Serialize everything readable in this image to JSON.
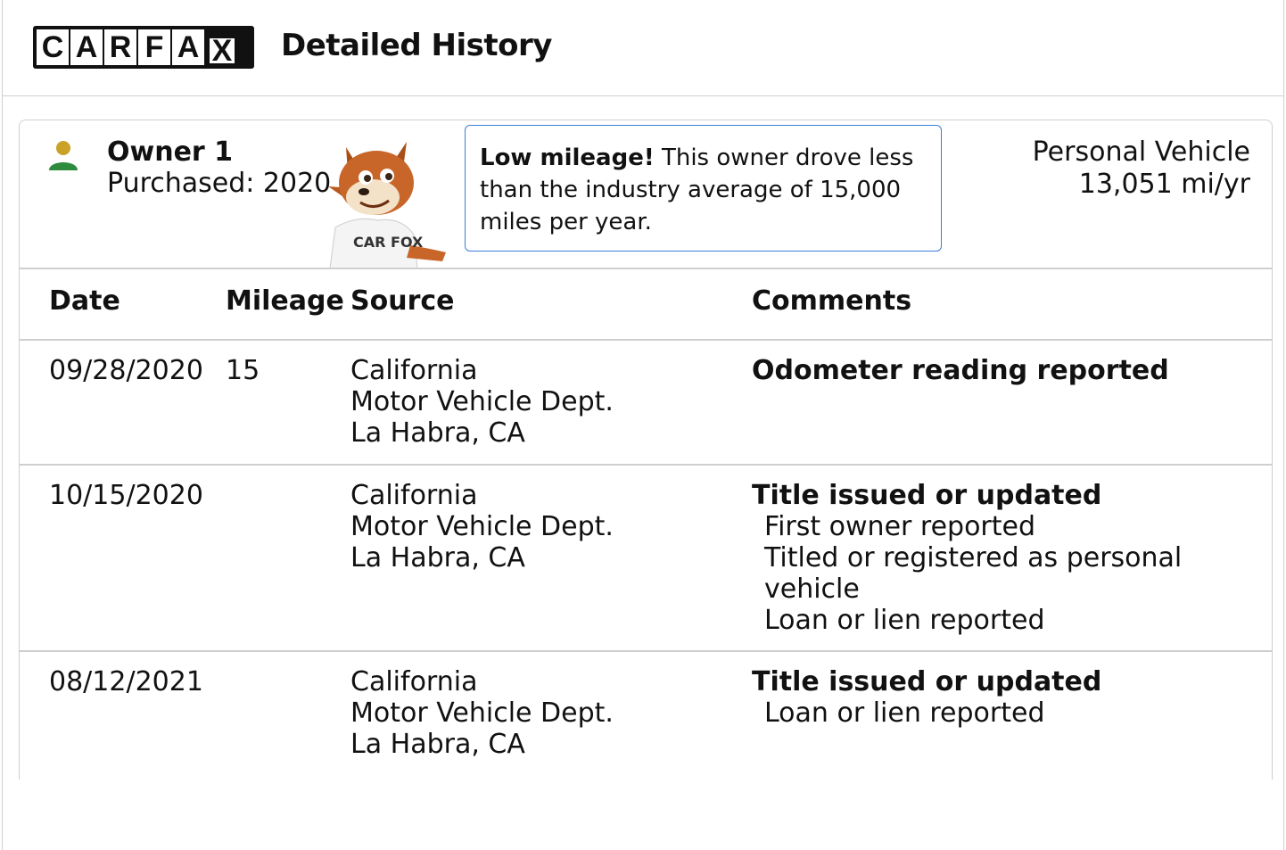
{
  "header": {
    "logo_letters": [
      "C",
      "A",
      "R",
      "F",
      "A",
      "X"
    ],
    "title": "Detailed History"
  },
  "owner": {
    "name": "Owner 1",
    "purchased": "Purchased: 2020",
    "icon": "person-icon",
    "mascot_shirt_text": "CAR FOX"
  },
  "callout": {
    "bold": "Low mileage!",
    "text": " This owner drove less than the industry average of 15,000 miles per year."
  },
  "vehicle": {
    "type": "Personal Vehicle",
    "rate": "13,051 mi/yr"
  },
  "table": {
    "columns": [
      "Date",
      "Mileage",
      "Source",
      "Comments"
    ],
    "rows": [
      {
        "date": "09/28/2020",
        "mileage": "15",
        "source": [
          "California",
          "Motor Vehicle Dept.",
          "La Habra, CA"
        ],
        "comment_title": "Odometer reading reported",
        "comment_details": []
      },
      {
        "date": "10/15/2020",
        "mileage": "",
        "source": [
          "California",
          "Motor Vehicle Dept.",
          "La Habra, CA"
        ],
        "comment_title": "Title issued or updated",
        "comment_details": [
          "First owner reported",
          "Titled or registered as personal vehicle",
          "Loan or lien reported"
        ]
      },
      {
        "date": "08/12/2021",
        "mileage": "",
        "source": [
          "California",
          "Motor Vehicle Dept.",
          "La Habra, CA"
        ],
        "comment_title": "Title issued or updated",
        "comment_details": [
          "Loan or lien reported"
        ]
      }
    ]
  },
  "colors": {
    "owner_icon_head": "#c9a227",
    "owner_icon_body": "#2e8b3e",
    "callout_border": "#3b7dd8",
    "divider": "#cfcfcf"
  }
}
